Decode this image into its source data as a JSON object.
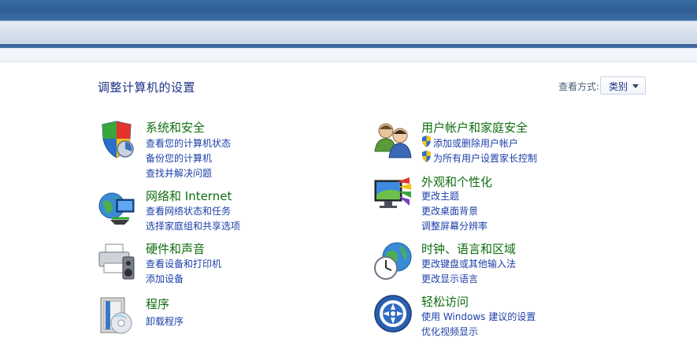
{
  "page": {
    "title": "调整计算机的设置",
    "view_label": "查看方式:",
    "view_value": "类别"
  },
  "categories": [
    {
      "id": "system-security",
      "icon": "shield-icon",
      "heading": "系统和安全",
      "links": [
        "查看您的计算机状态",
        "备份您的计算机",
        "查找并解决问题"
      ]
    },
    {
      "id": "network-internet",
      "icon": "globe-network-icon",
      "heading": "网络和 Internet",
      "links": [
        "查看网络状态和任务",
        "选择家庭组和共享选项"
      ]
    },
    {
      "id": "hardware-sound",
      "icon": "printer-icon",
      "heading": "硬件和声音",
      "links": [
        "查看设备和打印机",
        "添加设备"
      ]
    },
    {
      "id": "programs",
      "icon": "programs-icon",
      "heading": "程序",
      "links": [
        "卸载程序"
      ]
    },
    {
      "id": "user-accounts",
      "icon": "users-icon",
      "heading": "用户帐户和家庭安全",
      "links": [
        "添加或删除用户帐户",
        "为所有用户设置家长控制"
      ]
    },
    {
      "id": "appearance",
      "icon": "monitor-paint-icon",
      "heading": "外观和个性化",
      "links": [
        "更改主题",
        "更改桌面背景",
        "调整屏幕分辨率"
      ]
    },
    {
      "id": "clock-language-region",
      "icon": "clock-globe-icon",
      "heading": "时钟、语言和区域",
      "links": [
        "更改键盘或其他输入法",
        "更改显示语言"
      ]
    },
    {
      "id": "ease-of-access",
      "icon": "ease-of-access-icon",
      "heading": "轻松访问",
      "links": [
        "使用 Windows 建议的设置",
        "优化视频显示"
      ]
    }
  ],
  "colors": {
    "heading": "#106d10",
    "link": "#1c3fa8",
    "title": "#1e3287"
  }
}
